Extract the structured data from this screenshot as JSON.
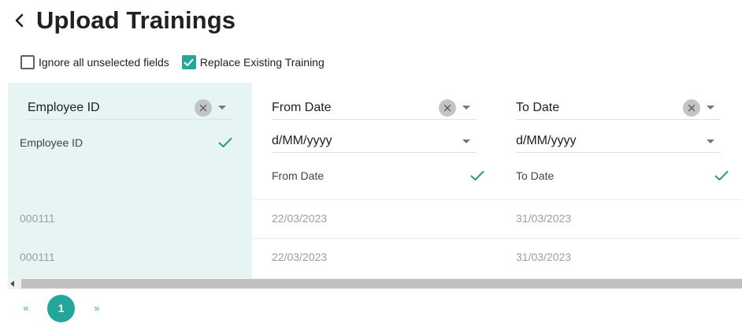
{
  "header": {
    "title": "Upload Trainings"
  },
  "options": {
    "ignore_unselected": {
      "label": "Ignore all unselected fields",
      "checked": false
    },
    "replace_existing": {
      "label": "Replace Existing Training",
      "checked": true
    }
  },
  "columns": [
    {
      "field": "Employee ID",
      "mapped_label": "Employee ID",
      "format": ""
    },
    {
      "field": "From Date",
      "mapped_label": "From Date",
      "format": "d/MM/yyyy"
    },
    {
      "field": "To Date",
      "mapped_label": "To Date",
      "format": "d/MM/yyyy"
    }
  ],
  "rows": [
    [
      "000111",
      "22/03/2023",
      "31/03/2023"
    ],
    [
      "000111",
      "22/03/2023",
      "31/03/2023"
    ]
  ],
  "pagination": {
    "prev": "«",
    "current": "1",
    "next": "»"
  },
  "colors": {
    "accent": "#26a69a",
    "first_column_bg": "#e6f4f3",
    "check": "#2e9e5b"
  }
}
